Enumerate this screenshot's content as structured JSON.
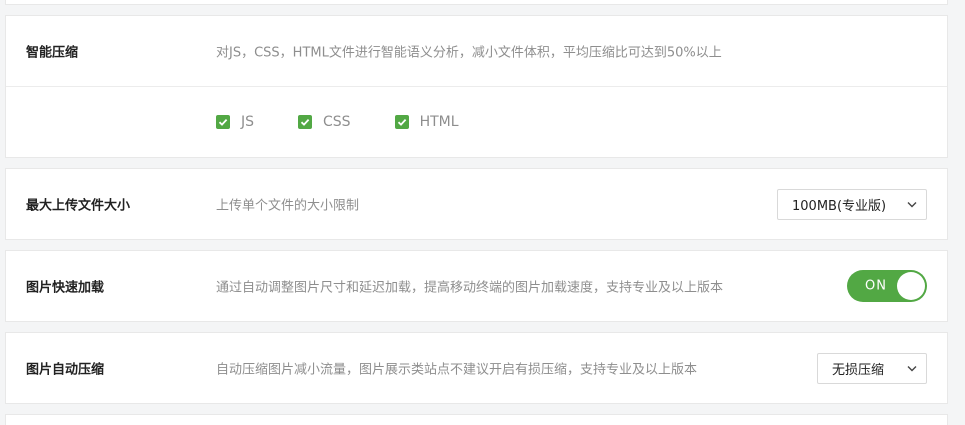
{
  "smart_compress": {
    "label": "智能压缩",
    "description": "对JS，CSS，HTML文件进行智能语义分析，减小文件体积，平均压缩比可达到50%以上",
    "options": [
      {
        "label": "JS",
        "checked": true
      },
      {
        "label": "CSS",
        "checked": true
      },
      {
        "label": "HTML",
        "checked": true
      }
    ]
  },
  "max_upload": {
    "label": "最大上传文件大小",
    "description": "上传单个文件的大小限制",
    "selected": "100MB(专业版)"
  },
  "image_fast_load": {
    "label": "图片快速加载",
    "description": "通过自动调整图片尺寸和延迟加载，提高移动终端的图片加载速度，支持专业及以上版本",
    "toggle_text": "ON",
    "enabled": true
  },
  "image_auto_compress": {
    "label": "图片自动压缩",
    "description": "自动压缩图片减小流量，图片展示类站点不建议开启有损压缩，支持专业及以上版本",
    "selected": "无损压缩"
  },
  "colors": {
    "accent_green": "#52a844",
    "label_text": "#222222",
    "desc_text": "#8e8e8e",
    "background": "#f4f5f6"
  },
  "icons": {
    "checkbox": "checkmark-icon",
    "select": "chevron-down-icon"
  }
}
